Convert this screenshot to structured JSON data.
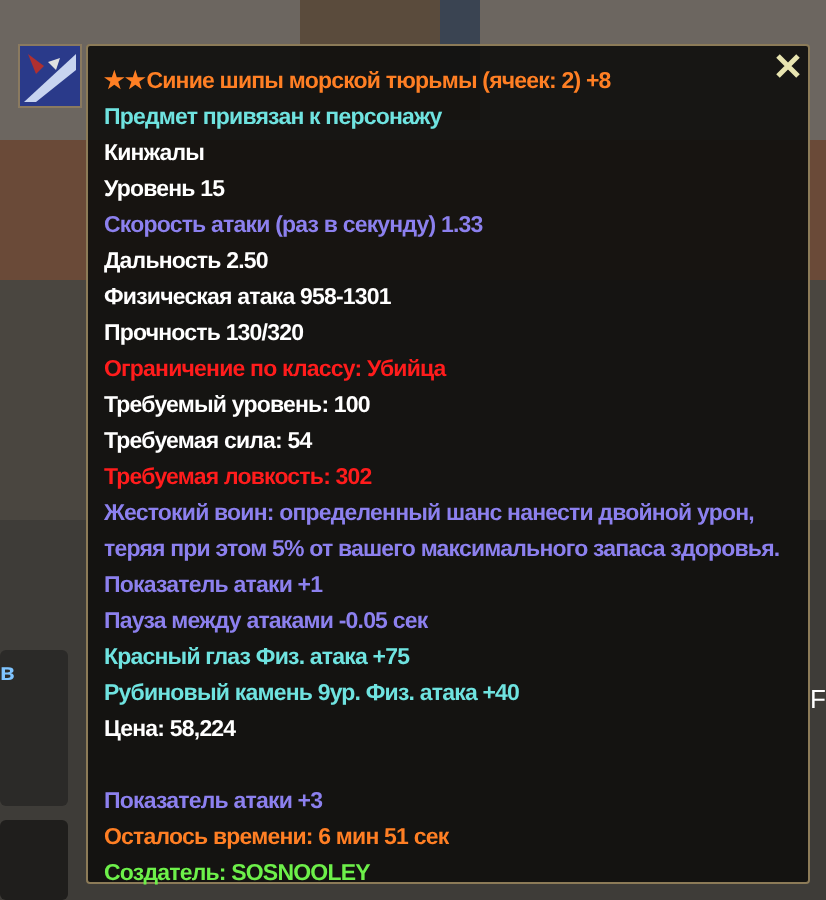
{
  "side_panel": {
    "text": "в"
  },
  "edge_text": "F",
  "tooltip": {
    "lines": [
      {
        "text": "★★Синие шипы морской тюрьмы (ячеек: 2) +8",
        "kind": "orange"
      },
      {
        "text": "Предмет привязан к персонажу",
        "kind": "cyan"
      },
      {
        "text": "Кинжалы",
        "kind": "white"
      },
      {
        "text": "Уровень 15",
        "kind": "white"
      },
      {
        "text": "Скорость атаки (раз в секунду) 1.33",
        "kind": "purple"
      },
      {
        "text": "Дальность 2.50",
        "kind": "white"
      },
      {
        "text": "Физическая атака 958-1301",
        "kind": "white"
      },
      {
        "text": "Прочность 130/320",
        "kind": "white"
      },
      {
        "text": "Ограничение по классу: Убийца",
        "kind": "red"
      },
      {
        "text": "Требуемый уровень: 100",
        "kind": "white"
      },
      {
        "text": "Требуемая сила: 54",
        "kind": "white"
      },
      {
        "text": "Требуемая ловкость: 302",
        "kind": "red"
      },
      {
        "text": "Жестокий воин: определенный шанс нанести двойной урон, теряя при этом 5% от вашего максимального запаса здоровья.",
        "kind": "purple"
      },
      {
        "text": "Показатель атаки +1",
        "kind": "purple"
      },
      {
        "text": "Пауза между атаками -0.05 сек",
        "kind": "purple"
      },
      {
        "text": "Красный глаз Физ. атака +75",
        "kind": "cyan"
      },
      {
        "text": "Рубиновый камень 9ур. Физ. атака +40",
        "kind": "cyan"
      },
      {
        "text": "Цена: 58,224",
        "kind": "white"
      },
      {
        "text": "Показатель атаки +3",
        "kind": "purple",
        "gap_before": true
      },
      {
        "text": "Осталось времени: 6 мин 51 сек",
        "kind": "orange"
      },
      {
        "text": "Создатель: SOSNOOLEY",
        "kind": "green"
      }
    ]
  }
}
